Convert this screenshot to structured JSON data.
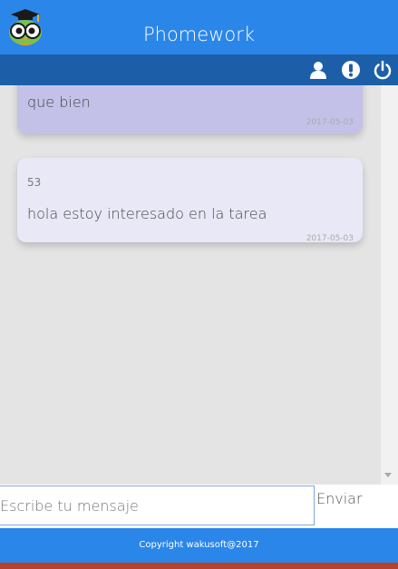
{
  "header": {
    "title": "Phomework",
    "logo_icon": "owl-graduate-icon",
    "bg_color": "#2b86e9"
  },
  "toolbar": {
    "bg_color": "#1c5fa8",
    "icons": [
      "user-icon",
      "info-icon",
      "power-icon"
    ]
  },
  "messages": [
    {
      "id": "",
      "text": "que bien",
      "date": "2017-05-03",
      "bg_color": "#c4c1e8"
    },
    {
      "id": "53",
      "text": "hola estoy interesado en la tarea",
      "date": "2017-05-03",
      "bg_color": "#e9e8f7"
    }
  ],
  "composer": {
    "placeholder": "Escribe tu mensaje",
    "send_label": "Enviar"
  },
  "footer": {
    "copyright": "Copyright wakusoft@2017"
  }
}
